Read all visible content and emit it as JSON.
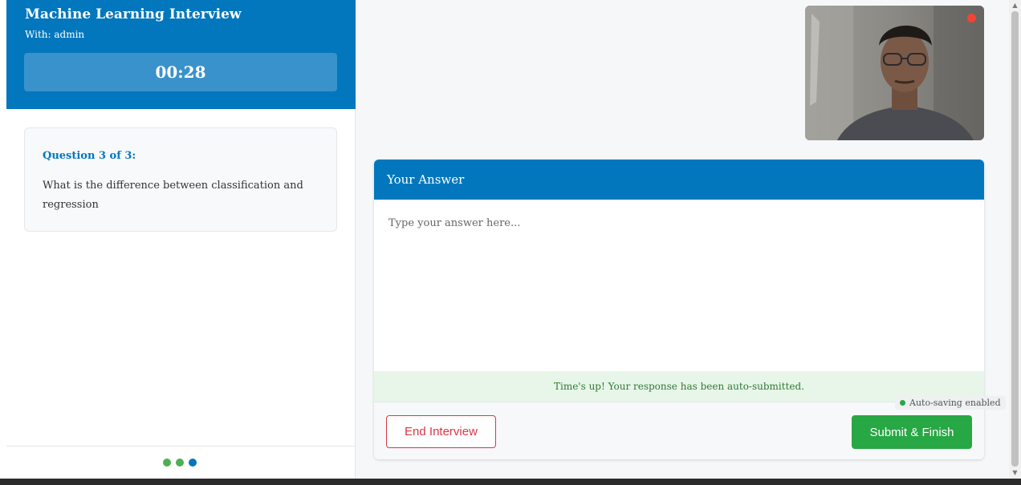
{
  "sidebar": {
    "title": "Machine Learning Interview",
    "interviewer": "With: admin",
    "timer": "00:28",
    "question": {
      "number_label": "Question 3 of 3:",
      "text": "What is the difference between classification and regression"
    },
    "progress": {
      "total": 3,
      "current": 3,
      "dot_colors": [
        "#4caf50",
        "#4caf50",
        "#0277bd"
      ]
    }
  },
  "main": {
    "answer": {
      "header": "Your Answer",
      "placeholder": "Type your answer here...",
      "value": "",
      "status_message": "Time's up! Your response has been auto-submitted."
    },
    "buttons": {
      "end_label": "End Interview",
      "submit_label": "Submit & Finish"
    },
    "autosave_label": "Auto-saving enabled",
    "webcam": {
      "recording": true
    }
  },
  "colors": {
    "primary": "#0277bd",
    "success": "#28a745",
    "danger": "#dc3545",
    "recording": "#f44336"
  }
}
